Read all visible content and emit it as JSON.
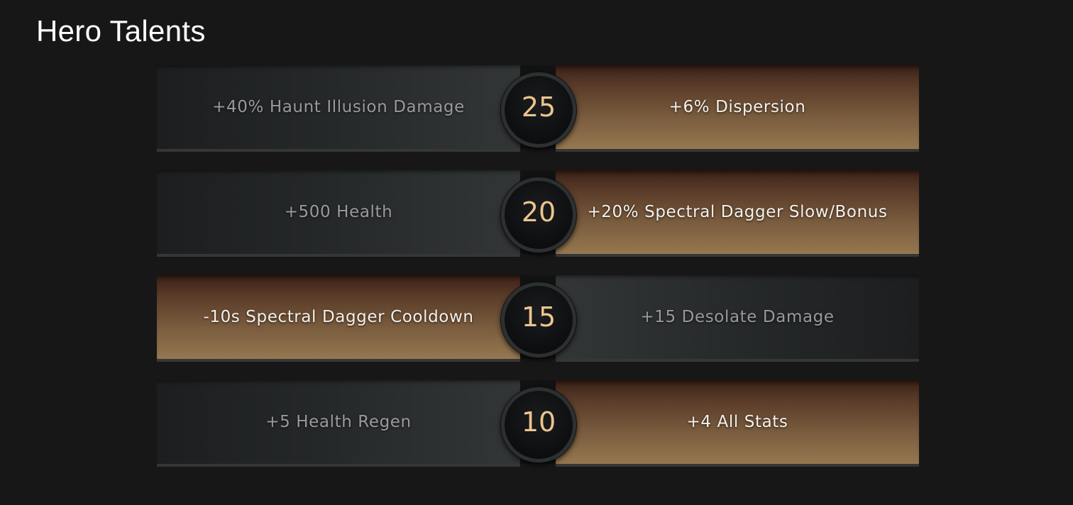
{
  "title": "Hero Talents",
  "tiers": [
    {
      "level": "25",
      "left": {
        "label": "+40% Haunt Illusion Damage",
        "selected": false
      },
      "right": {
        "label": "+6% Dispersion",
        "selected": true
      }
    },
    {
      "level": "20",
      "left": {
        "label": "+500 Health",
        "selected": false
      },
      "right": {
        "label": "+20% Spectral Dagger Slow/Bonus",
        "selected": true
      }
    },
    {
      "level": "15",
      "left": {
        "label": "-10s Spectral Dagger Cooldown",
        "selected": true
      },
      "right": {
        "label": "+15 Desolate Damage",
        "selected": false
      }
    },
    {
      "level": "10",
      "left": {
        "label": "+5 Health Regen",
        "selected": false
      },
      "right": {
        "label": "+4 All Stats",
        "selected": true
      }
    }
  ],
  "colors": {
    "background": "#171717",
    "selected_gradient_bottom": "#95784f",
    "unselected_text": "#9a9a9a",
    "level_number": "#ecc48f"
  }
}
